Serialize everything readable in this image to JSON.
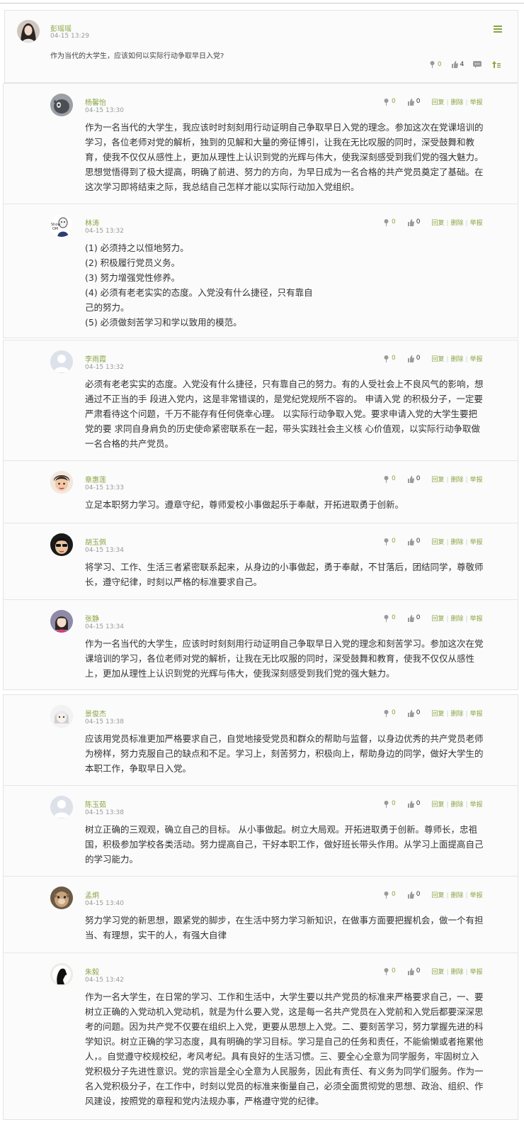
{
  "post": {
    "author": "彭瑶瑶",
    "time": "04-15 13:29",
    "question": "作为当代的大学生，应该如何以实际行动争取早日入党?",
    "flowers": "0",
    "likes": "4"
  },
  "reply_links": {
    "reply": "回复",
    "delete": "删除",
    "report": "举报",
    "sep": "|"
  },
  "replies": [
    {
      "author": "杨馨怡",
      "time": "04-15 13:30",
      "flowers": "0",
      "likes": "0",
      "paragraphs": [
        "作为一名当代的大学生，我应该时时刻刻用行动证明自己争取早日入党的理念。参加这次在党课培训的学习，各位老师对党的解析，独到的见解和大量的旁征博引，让我在无比叹服的同时，深受鼓舞和教育，使我不仅仅从感性上，更加从理性上认识到党的光辉与伟大，使我深刻感受到我们党的强大魅力。思想觉悟得到了极大提高，明确了前进、努力的方向，为早日成为一名合格的共产党员奠定了基础。在这次学习即将结束之际，我总结自己怎样才能以实际行动加入党组织。"
      ]
    },
    {
      "author": "林涛",
      "time": "04-15 13:32",
      "flowers": "0",
      "likes": "0",
      "paragraphs": [
        "(1) 必须持之以恒地努力。",
        "(2) 积极履行党员义务。",
        "(3) 努力增强党性修养。",
        "(4) 必须有老老实实的态度。入党没有什么捷径，只有靠自",
        "己的努力。",
        "(5) 必须做刻苦学习和学以致用的模范。"
      ]
    },
    {
      "author": "李雨霞",
      "time": "04-15 13:32",
      "flowers": "0",
      "likes": "0",
      "paragraphs": [
        "必须有老老实实的态度。入党没有什么捷径，只有靠自己的努力。有的人受社会上不良风气的影响，想通过不正当的手 段进入党内，这是非常错误的，是党纪党规所不容的。 申请入党 的积极分子，一定要严肃看待这个问题，千万不能存有任何侥幸心理。  以实际行动争取入党。要求申请入党的大学生要把党的要 求同自身肩负的历史使命紧密联系在一起，带头实践社会主义核 心价值观，以实际行动争取做一名合格的共产党员。"
      ]
    },
    {
      "author": "章惠莲",
      "time": "04-15 13:33",
      "flowers": "0",
      "likes": "0",
      "paragraphs": [
        "立足本职努力学习。遵章守纪，尊师爱校小事做起乐于奉献，开拓进取勇于创新。"
      ]
    },
    {
      "author": "胡玉佩",
      "time": "04-15 13:34",
      "flowers": "0",
      "likes": "0",
      "paragraphs": [
        "将学习、工作、生活三者紧密联系起来，从身边的小事做起，勇于奉献，不甘落后，团结同学，尊敬师长，遵守纪律，时刻以严格的标准要求自己。"
      ]
    },
    {
      "author": "张静",
      "time": "04-15 13:34",
      "flowers": "0",
      "likes": "0",
      "paragraphs": [
        "作为一名当代的大学生，应该时时刻刻用行动证明自己争取早日入党的理念和刻苦学习。参加这次在党课培训的学习，各位老师对党的解析，让我在无比叹服的同时，深受鼓舞和教育，使我不仅仅从感性上，更加从理性上认识到党的光辉与伟大，使我深刻感受到我们党的强大魅力。"
      ]
    },
    {
      "author": "景俊杰",
      "time": "04-15 13:38",
      "flowers": "0",
      "likes": "0",
      "paragraphs": [
        "应该用党员标准更加严格要求自己，自觉地接受党员和群众的帮助与监督，以身边优秀的共产党员老师为榜样，努力克服自己的缺点和不足。学习上，刻苦努力，积极向上，帮助身边的同学，做好大学生的本职工作，争取早日入党。"
      ]
    },
    {
      "author": "陈玉茹",
      "time": "04-15 13:38",
      "flowers": "0",
      "likes": "0",
      "paragraphs": [
        "树立正确的三观观，确立自己的目标。 从小事做起。树立大局观。开拓进取勇于创新。尊师长，忠祖国，积极参加学校各类活动。努力提高自己，干好本职工作，做好班长带头作用。从学习上面提高自己的学习能力。"
      ]
    },
    {
      "author": "孟炯",
      "time": "04-15 13:40",
      "flowers": "0",
      "likes": "0",
      "paragraphs": [
        "努力学习党的新思想，跟紧党的脚步，在生活中努力学习新知识，在做事方面要把握机会，做一个有担当、有理想，实干的人，有强大自律"
      ]
    },
    {
      "author": "朱毅",
      "time": "04-15 13:42",
      "flowers": "0",
      "likes": "0",
      "paragraphs": [
        "作为一名大学生，在日常的学习、工作和生活中，大学生要以共产党员的标准来严格要求自己，一、要树立正确的入党动机入党动机，就是为什么要入党，这是每一名共产党员在入党前和入党后都要深深思考的问题。因为共产党不仅要在组织上入党，更要从思想上入党。二、要刻苦学习，努力掌握先进的科学知识。树立正确的学习态度，具有明确的学习目标。学习是自己的任务和责任，不能偷懒或者拖累他人，。自觉遵守校规校纪，考风考纪。具有良好的生活习惯。三、要全心全意为同学服务，牢固树立入党积极分子先进性意识。党的宗旨是全心全意为人民服务，因此有责任、有义务为同学们服务。作为一名入党积极分子，在工作中，时刻以党员的标准来衡量自己，必须全面贯彻党的思想、政治、组织、作风建设，按照党的章程和党内法规办事，严格遵守党的纪律。"
      ]
    }
  ]
}
